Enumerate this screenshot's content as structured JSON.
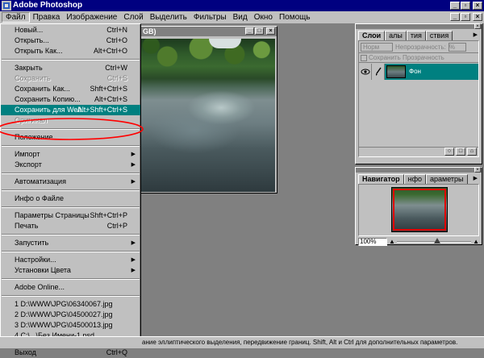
{
  "app": {
    "title": "Adobe Photoshop",
    "accent_color": "#000080",
    "highlight_color": "#008080"
  },
  "window_buttons": {
    "minimize": "_",
    "restore": "▫",
    "close": "×"
  },
  "menubar": {
    "items": [
      "Файл",
      "Правка",
      "Изображение",
      "Слой",
      "Выделить",
      "Фильтры",
      "Вид",
      "Окно",
      "Помощь"
    ]
  },
  "document": {
    "title": "GB)",
    "buttons": {
      "minimize": "_",
      "maximize": "□",
      "close": "×"
    }
  },
  "file_menu": {
    "groups": [
      [
        {
          "label": "Новый...",
          "shortcut": "Ctrl+N",
          "state": "normal"
        },
        {
          "label": "Открыть...",
          "shortcut": "Ctrl+O",
          "state": "normal"
        },
        {
          "label": "Открыть Как...",
          "shortcut": "Alt+Ctrl+O",
          "state": "normal"
        }
      ],
      [
        {
          "label": "Закрыть",
          "shortcut": "Ctrl+W",
          "state": "normal"
        },
        {
          "label": "Сохранить",
          "shortcut": "Ctrl+S",
          "state": "disabled"
        },
        {
          "label": "Сохранить Как...",
          "shortcut": "Shft+Ctrl+S",
          "state": "normal"
        },
        {
          "label": "Сохранить Копию...",
          "shortcut": "Alt+Ctrl+S",
          "state": "normal"
        },
        {
          "label": "Сохранить для Web...",
          "shortcut": "Alt+Shft+Ctrl+S",
          "state": "highlight"
        },
        {
          "label": "Оригинал",
          "shortcut": "",
          "state": "disabled"
        }
      ],
      [
        {
          "label": "Положение",
          "shortcut": "",
          "state": "normal"
        }
      ],
      [
        {
          "label": "Импорт",
          "shortcut": "",
          "state": "submenu"
        },
        {
          "label": "Экспорт",
          "shortcut": "",
          "state": "submenu"
        }
      ],
      [
        {
          "label": "Автоматизация",
          "shortcut": "",
          "state": "submenu"
        }
      ],
      [
        {
          "label": "Инфо о Файле",
          "shortcut": "",
          "state": "normal"
        }
      ],
      [
        {
          "label": "Параметры Страницы",
          "shortcut": "Shft+Ctrl+P",
          "state": "normal"
        },
        {
          "label": "Печать",
          "shortcut": "Ctrl+P",
          "state": "normal"
        }
      ],
      [
        {
          "label": "Запустить",
          "shortcut": "",
          "state": "submenu"
        }
      ],
      [
        {
          "label": "Настройки...",
          "shortcut": "",
          "state": "submenu"
        },
        {
          "label": "Установки Цвета",
          "shortcut": "",
          "state": "submenu"
        }
      ],
      [
        {
          "label": "Adobe Online...",
          "shortcut": "",
          "state": "normal"
        }
      ],
      [
        {
          "label": "1 D:\\WWW\\JPG\\06340067.jpg",
          "shortcut": "",
          "state": "normal"
        },
        {
          "label": "2 D:\\WWW\\JPG\\04500027.jpg",
          "shortcut": "",
          "state": "normal"
        },
        {
          "label": "3 D:\\WWW\\JPG\\04500013.jpg",
          "shortcut": "",
          "state": "normal"
        },
        {
          "label": "4 C:\\...\\Без Имени-1.psd",
          "shortcut": "",
          "state": "normal"
        }
      ],
      [
        {
          "label": "Выход",
          "shortcut": "Ctrl+Q",
          "state": "normal"
        }
      ]
    ]
  },
  "layers_palette": {
    "tabs": [
      "Слои",
      "алы",
      "тия",
      "ствия"
    ],
    "blend_mode": "Норм",
    "opacity_label": "Непрозрачность:",
    "opacity_value": "%",
    "preserve_transparency": "Сохранить Прозрачность",
    "layer_name": "Фон"
  },
  "navigator_palette": {
    "tabs": [
      "Навигатор",
      "нфо",
      "араметры"
    ],
    "zoom": "100%"
  },
  "status_bar": {
    "text": "ание эллиптического выделения, передвижение границ. Shift, Alt и Ctrl для дополнительных параметров."
  }
}
